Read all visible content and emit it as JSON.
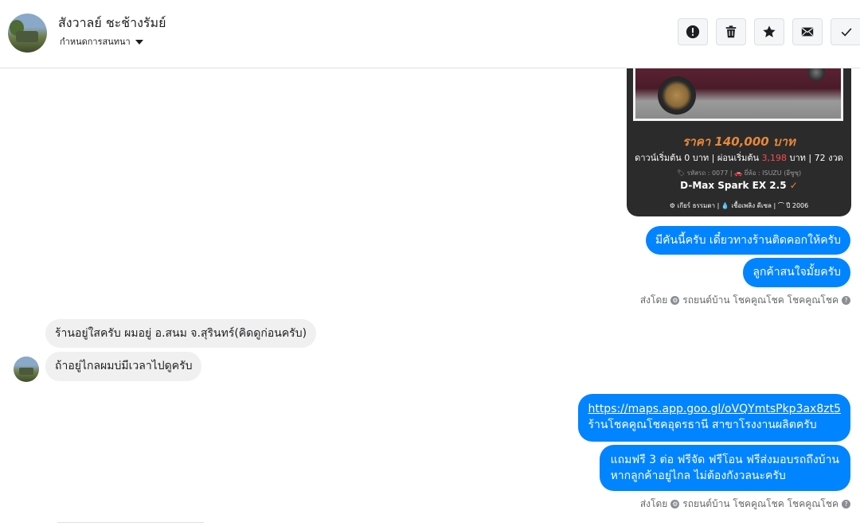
{
  "header": {
    "name": "สังวาลย์ ชะช้างรัมย์",
    "subtitle": "กำหนดการสนทนา",
    "actions": {
      "report": "report-icon",
      "delete": "trash-icon",
      "star": "star-icon",
      "mail": "mail-icon",
      "done": "check-icon"
    }
  },
  "card": {
    "price": "ราคา 140,000 บาท",
    "terms_prefix": "ดาวน์เริ่มต้น 0 บาท | ผ่อนเริ่มต้น ",
    "terms_red": "3,198",
    "terms_suffix": " บาท | 72 งวด",
    "specs": "🏷 รหัสรถ : 0077 | 🚗 ยี่ห้อ : ISUZU (อีซูซุ)",
    "model": "D-Max Spark EX 2.5",
    "model_check": "✓",
    "meta": "⚙ เกียร์ ธรรมดา | 💧 เชื้อเพลิง ดีเซล | ⌒ ปี 2006",
    "price_color": "#e7883a",
    "accent_red": "#ff4a4a"
  },
  "messages": {
    "out1": "มีคันนี้ครับ เดี๋ยวทางร้านติดคอกให้ครับ",
    "out2": "ลูกค้าสนใจมั้ยครับ",
    "sent_by_1": {
      "label": "ส่งโดย",
      "sender": "รถยนต์บ้าน โชคคูณโชค โชคคูณโชค"
    },
    "in1": "ร้านอยู่ใสครับ ผมอยู่ อ.สนม จ.สุรินทร์(คิดดูก่อนครับ)",
    "in2": "ถ้าอยู่ไกลผมบ่มีเวลาไปดูครับ",
    "out3_link": "https://maps.app.goo.gl/oVQYmtsPkp3ax8zt5",
    "out3_text": "ร้านโชคคูณโชคอุดรธานี สาขาโรงงานผลิตครับ",
    "out4_line1": "แถมฟรี 3 ต่อ ฟรีจัด ฟรีโอน  ฟรีส่งมอบรถถึงบ้าน",
    "out4_line2": "หากลูกค้าอยู่ไกล ไม่ต้องกังวลนะครับ",
    "sent_by_2": {
      "label": "ส่งโดย",
      "sender": "รถยนต์บ้าน โชคคูณโชค โชคคูณโชค"
    }
  },
  "colors": {
    "outgoing_bubble": "#0084ff",
    "incoming_bubble": "#f1f0f0",
    "card_bg": "#2b2b2b"
  }
}
